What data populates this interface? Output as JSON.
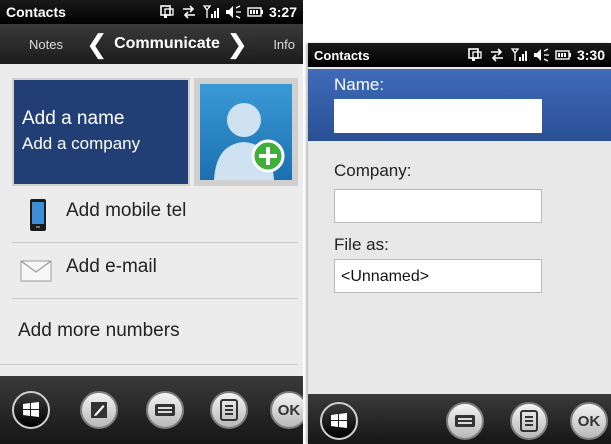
{
  "left": {
    "app_title": "Contacts",
    "time": "3:27",
    "nav": {
      "prev": "Notes",
      "current": "Communicate",
      "next": "Info"
    },
    "name_placeholder": "Add a name",
    "company_placeholder": "Add a company",
    "rows": [
      {
        "label": "Add mobile tel",
        "icon": "mobile-phone-icon"
      },
      {
        "label": "Add e-mail",
        "icon": "envelope-icon"
      }
    ],
    "more": "Add more numbers",
    "softkeys": [
      "windows-start-icon",
      "edit-icon",
      "keyboard-icon",
      "menu-icon"
    ],
    "ok": "OK"
  },
  "right": {
    "app_title": "Contacts",
    "time": "3:30",
    "fields": [
      {
        "label": "Name:",
        "value": ""
      },
      {
        "label": "Company:",
        "value": ""
      },
      {
        "label": "File as:",
        "value": "<Unnamed>"
      }
    ],
    "softkeys": [
      "windows-start-icon",
      "keyboard-icon",
      "menu-icon"
    ],
    "ok": "OK"
  },
  "colors": {
    "selected_blue": "#223f75",
    "active_field_blue": "#2f5aa8",
    "bar_dark": "#1c1c1c"
  }
}
